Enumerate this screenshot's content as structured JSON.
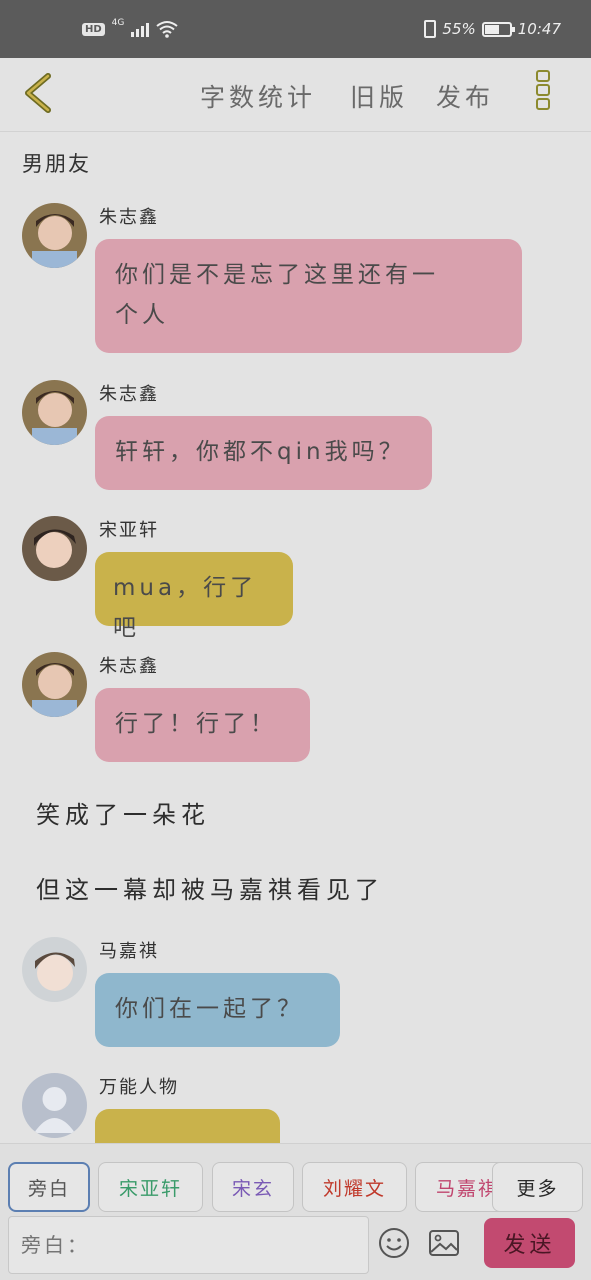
{
  "status_bar": {
    "hd": "HD",
    "network": "4G",
    "battery": "55%",
    "time": "10:47"
  },
  "header": {
    "word_count": "字数统计",
    "old_version": "旧版",
    "publish": "发布"
  },
  "chat_title": "男朋友",
  "messages": [
    {
      "speaker": "朱志鑫",
      "text_lines": [
        "你们是不是忘了这里还有一",
        "个人"
      ],
      "color": "#d9a1ae"
    },
    {
      "speaker": "朱志鑫",
      "text": "轩轩，你都不qin我吗？",
      "color": "#d9a1ae"
    },
    {
      "speaker": "宋亚轩",
      "text": "mua，行了吧",
      "color": "#c9b24b"
    },
    {
      "speaker": "朱志鑫",
      "text": "行了！行了！",
      "color": "#d9a1ae"
    },
    {
      "speaker": "马嘉祺",
      "text": "你们在一起了？",
      "color": "#8fb7cd"
    },
    {
      "speaker": "万能人物",
      "text": "",
      "color": "#c9b24b"
    }
  ],
  "narrations": [
    "笑成了一朵花",
    "但这一幕却被马嘉祺看见了"
  ],
  "characters": [
    "旁白",
    "宋亚轩",
    "宋玄",
    "刘耀文",
    "马嘉祺",
    "更多"
  ],
  "character_colors": [
    "#555555",
    "#3a9b6a",
    "#7a5ab5",
    "#c0392b",
    "#c0456e",
    "#555555"
  ],
  "input": {
    "placeholder": "旁白："
  },
  "send_label": "发送"
}
